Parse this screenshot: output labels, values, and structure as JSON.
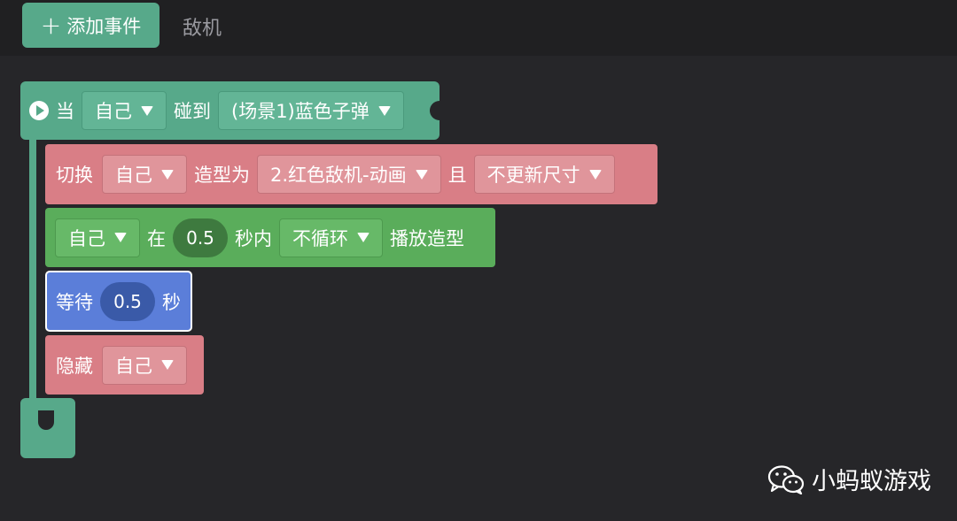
{
  "topbar": {
    "add_event_label": "添加事件",
    "tab_label": "敌机"
  },
  "hat": {
    "when_label": "当",
    "subject": "自己",
    "collide_label": "碰到",
    "target": "(场景1)蓝色子弹"
  },
  "switch_costume": {
    "label": "切换",
    "subject": "自己",
    "costume_label": "造型为",
    "costume": "2.红色敌机-动画",
    "and_label": "且",
    "size_option": "不更新尺寸"
  },
  "play_costume": {
    "subject": "自己",
    "in_label": "在",
    "seconds": "0.5",
    "within_label": "秒内",
    "loop_option": "不循环",
    "action_label": "播放造型"
  },
  "wait": {
    "label": "等待",
    "seconds": "0.5",
    "unit": "秒"
  },
  "hide": {
    "label": "隐藏",
    "subject": "自己"
  },
  "watermark": {
    "text": "小蚂蚁游戏"
  },
  "colors": {
    "event": "#57a98a",
    "looks": "#d97e86",
    "animation": "#5aad5b",
    "control": "#5b7ed9",
    "background": "#262629"
  }
}
